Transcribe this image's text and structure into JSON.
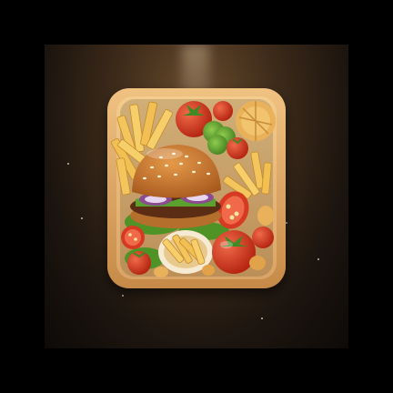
{
  "image": {
    "subject": "food-tray-app-icon",
    "colors": {
      "background_center": "#6b4d2e",
      "background_edge": "#0d0a08",
      "tray_wood": "#d9a766",
      "tray_inner": "#f0c685",
      "bun": "#c9792e",
      "fries": "#f3c15a",
      "tomato": "#d63a22",
      "lettuce": "#5aa12e",
      "onion": "#8a4c8f"
    }
  }
}
